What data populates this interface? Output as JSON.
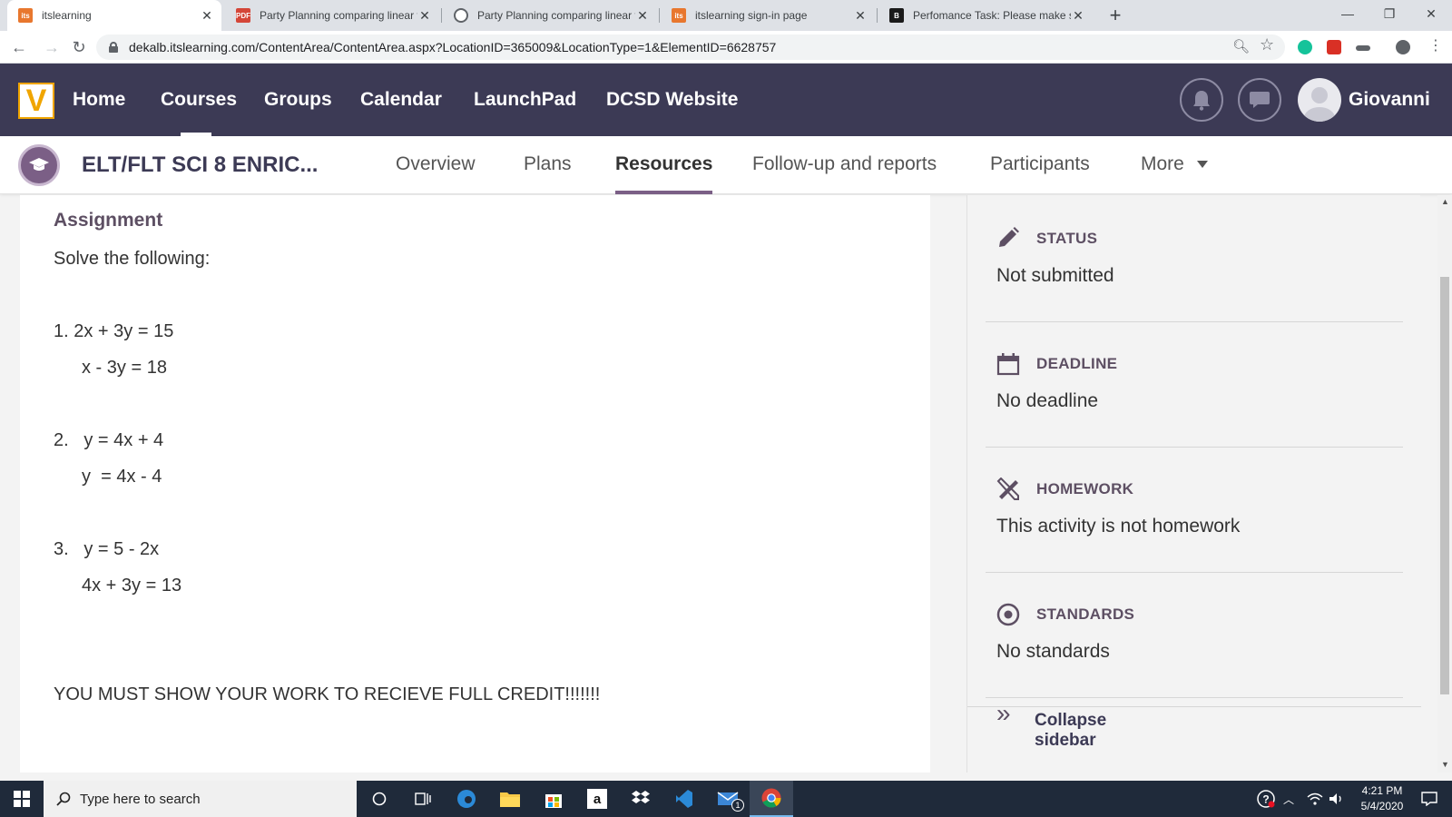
{
  "browser": {
    "tabs": [
      {
        "title": "itslearning",
        "favicon": "its-favicon",
        "active": true
      },
      {
        "title": "Party Planning comparing linear f",
        "favicon": "pdf-favicon",
        "active": false
      },
      {
        "title": "Party Planning comparing linear f",
        "favicon": "globe-favicon",
        "active": false
      },
      {
        "title": "itslearning sign-in page",
        "favicon": "its-favicon",
        "active": false
      },
      {
        "title": "Perfomance Task: Please make su",
        "favicon": "brainly-favicon",
        "active": false
      }
    ],
    "url": "dekalb.itslearning.com/ContentArea/ContentArea.aspx?LocationID=365009&LocationType=1&ElementID=6628757"
  },
  "header": {
    "nav": [
      "Home",
      "Courses",
      "Groups",
      "Calendar",
      "LaunchPad",
      "DCSD Website"
    ],
    "username": "Giovanni"
  },
  "course": {
    "title": "ELT/FLT SCI 8 ENRIC...",
    "tabs": [
      "Overview",
      "Plans",
      "Resources",
      "Follow-up and reports",
      "Participants",
      "More"
    ],
    "active_tab": "Resources"
  },
  "assignment": {
    "heading": "Assignment",
    "lines": [
      "Solve the following:",
      "1. 2x + 3y = 15",
      "x - 3y = 18",
      "2.   y = 4x + 4",
      "y  = 4x - 4",
      "3.   y = 5 - 2x",
      "4x + 3y = 13",
      "YOU MUST SHOW YOUR WORK TO RECIEVE FULL CREDIT!!!!!!!"
    ]
  },
  "sidebar": {
    "status_label": "STATUS",
    "status_value": "Not submitted",
    "deadline_label": "DEADLINE",
    "deadline_value": "No deadline",
    "homework_label": "HOMEWORK",
    "homework_value": "This activity is not homework",
    "standards_label": "STANDARDS",
    "standards_value": "No standards",
    "collapse_label": "Collapse sidebar"
  },
  "taskbar": {
    "search_placeholder": "Type here to search",
    "time": "4:21 PM",
    "date": "5/4/2020",
    "mail_badge": "1"
  },
  "colors": {
    "header_bg": "#3c3a55",
    "accent": "#7b5f86",
    "logo": "#f0a500"
  }
}
